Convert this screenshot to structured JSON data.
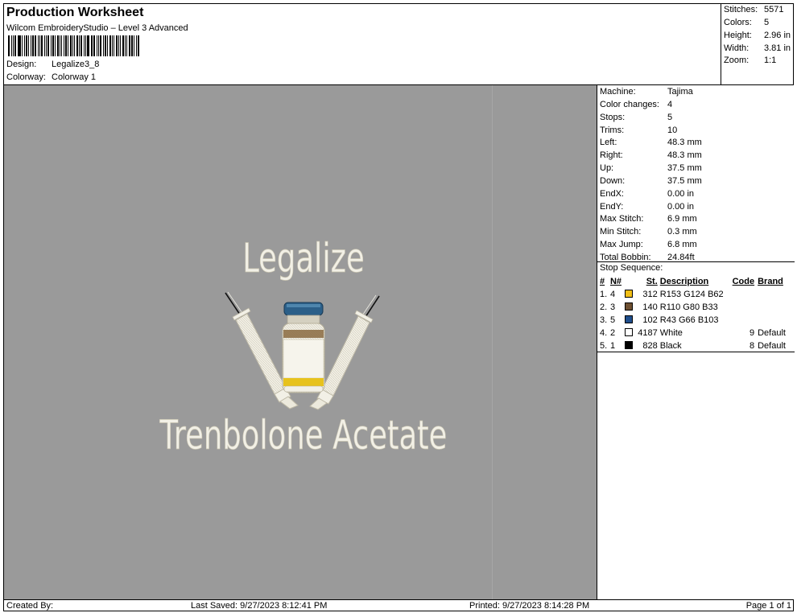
{
  "header": {
    "title": "Production Worksheet",
    "subtitle": "Wilcom EmbroideryStudio – Level 3 Advanced",
    "design_label": "Design:",
    "design_value": "Legalize3_8",
    "colorway_label": "Colorway:",
    "colorway_value": "Colorway 1"
  },
  "stats": {
    "stitches_label": "Stitches:",
    "stitches": "5571",
    "colors_label": "Colors:",
    "colors": "5",
    "height_label": "Height:",
    "height": "2.96 in",
    "width_label": "Width:",
    "width": "3.81 in",
    "zoom_label": "Zoom:",
    "zoom": "1:1"
  },
  "design": {
    "top_text": "Legalize",
    "bottom_text": "Trenbolone Acetate",
    "background_color": "#9a9a9a",
    "thread_white": "#f2f0e6",
    "thread_yellow": "#e7c21d",
    "thread_brown": "#8a6a3f",
    "thread_blue": "#2b5f88",
    "thread_black": "#111111"
  },
  "info": {
    "machine_label": "Machine:",
    "machine": "Tajima",
    "color_changes_label": "Color changes:",
    "color_changes": "4",
    "stops_label": "Stops:",
    "stops": "5",
    "trims_label": "Trims:",
    "trims": "10",
    "left_label": "Left:",
    "left": "48.3 mm",
    "right_label": "Right:",
    "right": "48.3 mm",
    "up_label": "Up:",
    "up": "37.5 mm",
    "down_label": "Down:",
    "down": "37.5 mm",
    "endx_label": "EndX:",
    "endx": "0.00 in",
    "endy_label": "EndY:",
    "endy": "0.00 in",
    "max_stitch_label": "Max Stitch:",
    "max_stitch": "6.9 mm",
    "min_stitch_label": "Min Stitch:",
    "min_stitch": "0.3 mm",
    "max_jump_label": "Max Jump:",
    "max_jump": "6.8 mm",
    "total_bobbin_label": "Total Bobbin:",
    "total_bobbin": "24.84ft"
  },
  "stop_sequence": {
    "title": "Stop Sequence:",
    "headers": {
      "idx": "#",
      "needle": "N#",
      "st": "St.",
      "desc": "Description",
      "code": "Code",
      "brand": "Brand"
    },
    "rows": [
      {
        "idx": "1.",
        "needle": "4",
        "color": "#F2BF16",
        "st": "312",
        "desc": "R153 G124 B62",
        "code": "",
        "brand": ""
      },
      {
        "idx": "2.",
        "needle": "3",
        "color": "#6E5032",
        "st": "140",
        "desc": "R110 G80 B33",
        "code": "",
        "brand": ""
      },
      {
        "idx": "3.",
        "needle": "5",
        "color": "#1F4E8C",
        "st": "102",
        "desc": "R43 G66 B103",
        "code": "",
        "brand": ""
      },
      {
        "idx": "4.",
        "needle": "2",
        "color": "#FFFFFF",
        "st": "4187",
        "desc": "White",
        "code": "9",
        "brand": "Default"
      },
      {
        "idx": "5.",
        "needle": "1",
        "color": "#000000",
        "st": "828",
        "desc": "Black",
        "code": "8",
        "brand": "Default"
      }
    ]
  },
  "footer": {
    "created_by": "Created By:",
    "last_saved": "Last Saved: 9/27/2023 8:12:41 PM",
    "printed": "Printed: 9/27/2023 8:14:28 PM",
    "page": "Page 1 of 1"
  }
}
